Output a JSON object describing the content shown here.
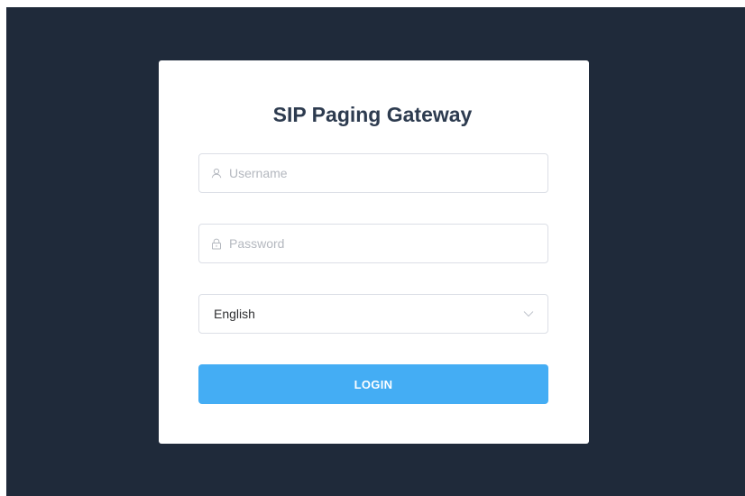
{
  "login": {
    "title": "SIP Paging Gateway",
    "username": {
      "placeholder": "Username",
      "value": "",
      "icon": "user-icon"
    },
    "password": {
      "placeholder": "Password",
      "value": "",
      "icon": "lock-icon"
    },
    "language": {
      "selected": "English",
      "icon": "chevron-down-icon"
    },
    "submit_label": "LOGIN"
  },
  "colors": {
    "background": "#1f2a3a",
    "card": "#ffffff",
    "title": "#2d3b4f",
    "accent": "#44adf4",
    "border": "#dcdfe6",
    "placeholder": "#b4b8bf"
  }
}
